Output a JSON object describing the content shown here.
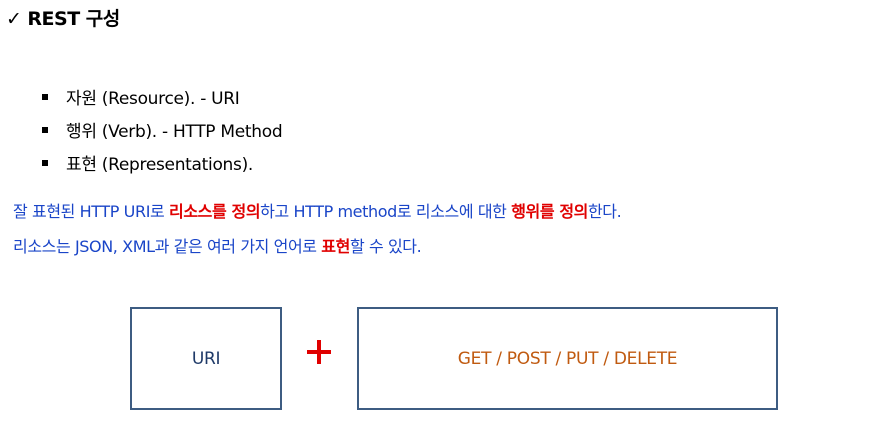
{
  "title": {
    "check": "✓",
    "text": "REST 구성"
  },
  "bullets": [
    "자원 (Resource). - URI",
    "행위 (Verb). - HTTP Method",
    "표현 (Representations)."
  ],
  "description": {
    "line1": {
      "p1": "잘 표현된 HTTP URI로 ",
      "em1": "리소스를 정의",
      "p2": "하고 HTTP method로 리소스에 대한 ",
      "em2": "행위를 정의",
      "p3": "한다."
    },
    "line2": {
      "p1": "리소스는 JSON, XML과 같은 여러 가지 언어로 ",
      "em1": "표현",
      "p2": "할 수 있다."
    }
  },
  "diagram": {
    "uri_label": "URI",
    "methods_label": "GET / POST / PUT / DELETE",
    "box_border_color": "#3d5c82",
    "plus_color": "#e00000",
    "methods_color": "#c05a10"
  },
  "colors": {
    "description_text": "#1a45c8",
    "emphasis": "#e00000"
  }
}
